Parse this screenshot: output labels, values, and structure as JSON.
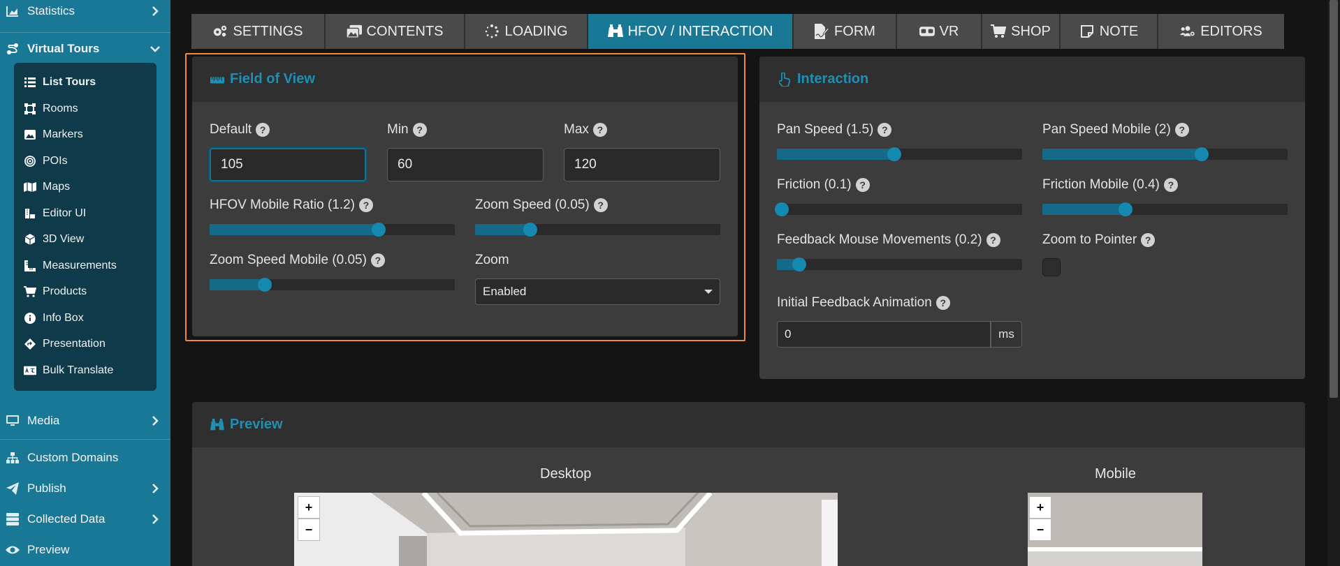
{
  "sidebar": {
    "items": [
      {
        "label": "Statistics",
        "icon": "chart-area-icon"
      },
      {
        "label": "Virtual Tours",
        "icon": "route-icon"
      },
      {
        "label": "Media",
        "icon": "desktop-icon"
      },
      {
        "label": "Custom Domains",
        "icon": "sitemap-icon"
      },
      {
        "label": "Publish",
        "icon": "paper-plane-icon"
      },
      {
        "label": "Collected Data",
        "icon": "database-icon"
      },
      {
        "label": "Preview",
        "icon": "eye-icon"
      }
    ],
    "submenu": [
      {
        "label": "List Tours"
      },
      {
        "label": "Rooms"
      },
      {
        "label": "Markers"
      },
      {
        "label": "POIs"
      },
      {
        "label": "Maps"
      },
      {
        "label": "Editor UI"
      },
      {
        "label": "3D View"
      },
      {
        "label": "Measurements"
      },
      {
        "label": "Products"
      },
      {
        "label": "Info Box"
      },
      {
        "label": "Presentation"
      },
      {
        "label": "Bulk Translate"
      }
    ]
  },
  "tabs": [
    {
      "label": "SETTINGS",
      "icon": "cogs-icon"
    },
    {
      "label": "CONTENTS",
      "icon": "images-icon"
    },
    {
      "label": "LOADING",
      "icon": "spinner-icon"
    },
    {
      "label": "HFOV / INTERACTION",
      "icon": "binoculars-icon",
      "active": true
    },
    {
      "label": "FORM",
      "icon": "file-signature-icon"
    },
    {
      "label": "VR",
      "icon": "vr-headset-icon"
    },
    {
      "label": "SHOP",
      "icon": "cart-icon"
    },
    {
      "label": "NOTE",
      "icon": "sticky-note-icon"
    },
    {
      "label": "EDITORS",
      "icon": "users-cog-icon"
    }
  ],
  "fov": {
    "title": "Field of View",
    "default_label": "Default",
    "default_value": "105",
    "min_label": "Min",
    "min_value": "60",
    "max_label": "Max",
    "max_value": "120",
    "hfov_mobile_ratio_label": "HFOV Mobile Ratio (1.2)",
    "hfov_mobile_ratio_level": 0.69,
    "zoom_speed_label": "Zoom Speed (0.05)",
    "zoom_speed_level": 0.225,
    "zoom_speed_mobile_label": "Zoom Speed Mobile (0.05)",
    "zoom_speed_mobile_level": 0.225,
    "zoom_label": "Zoom",
    "zoom_value": "Enabled"
  },
  "interaction": {
    "title": "Interaction",
    "pan_speed_label": "Pan Speed (1.5)",
    "pan_speed_level": 0.48,
    "pan_speed_mobile_label": "Pan Speed Mobile (2)",
    "pan_speed_mobile_level": 0.65,
    "friction_label": "Friction (0.1)",
    "friction_level": 0.02,
    "friction_mobile_label": "Friction Mobile (0.4)",
    "friction_mobile_level": 0.34,
    "feedback_label": "Feedback Mouse Movements (0.2)",
    "feedback_level": 0.09,
    "zoom_to_pointer_label": "Zoom to Pointer",
    "initial_feedback_label": "Initial Feedback Animation",
    "initial_feedback_value": "0",
    "initial_feedback_unit": "ms"
  },
  "preview": {
    "title": "Preview",
    "desktop_label": "Desktop",
    "mobile_label": "Mobile",
    "zoom_in": "+",
    "zoom_out": "−"
  },
  "help_glyph": "?",
  "colors": {
    "accent": "#1a7897",
    "highlight_border": "#f08a3c",
    "panel": "#3c3c3c"
  }
}
